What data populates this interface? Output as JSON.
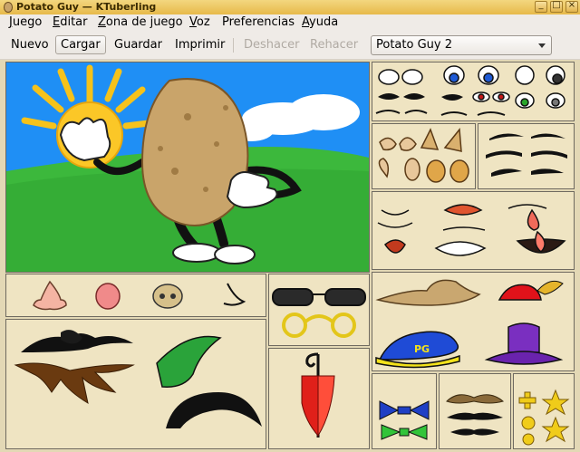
{
  "window": {
    "title": "Potato Guy — KTuberling",
    "buttons": {
      "minimize": "minimize-icon",
      "maximize": "maximize-icon",
      "close": "close-icon"
    }
  },
  "menubar": {
    "items": [
      {
        "label": "Juego",
        "mnemonic": "J",
        "rest": "uego"
      },
      {
        "label": "Editar",
        "mnemonic": "E",
        "rest": "ditar"
      },
      {
        "label": "Zona de juego",
        "mnemonic": "Z",
        "rest": "ona de juego"
      },
      {
        "label": "Voz",
        "mnemonic": "V",
        "rest": "oz"
      },
      {
        "label": "Preferencias",
        "mnemonic": "",
        "rest": "Preferencias"
      },
      {
        "label": "Ayuda",
        "mnemonic": "A",
        "rest": "yuda"
      }
    ]
  },
  "toolbar": {
    "nuevo": "Nuevo",
    "cargar": "Cargar",
    "guardar": "Guardar",
    "imprimir": "Imprimir",
    "deshacer": "Deshacer",
    "rehacer": "Rehacer"
  },
  "playground_select": {
    "value": "Potato Guy 2"
  },
  "colors": {
    "accent_title": "#e7b94a",
    "sky": "#1e90ff",
    "grass": "#3cb83c",
    "potato": "#c9a46a",
    "panel_bg": "#efe4c2"
  },
  "palette_items": {
    "eyes": "eyes-palette",
    "ears": "ears-palette",
    "eyebrows": "eyebrows-palette",
    "mouths": "mouths-palette",
    "noses": "noses-palette",
    "glasses": "glasses-palette",
    "hats": "hats-palette",
    "moustaches_hair": "moustaches-hair-palette",
    "umbrella": "umbrella-palette",
    "bowties": "bowtie-palette",
    "small_moustaches": "small-moustaches-palette",
    "badges": "badges-palette"
  },
  "scene": {
    "hat_text": "PG"
  }
}
